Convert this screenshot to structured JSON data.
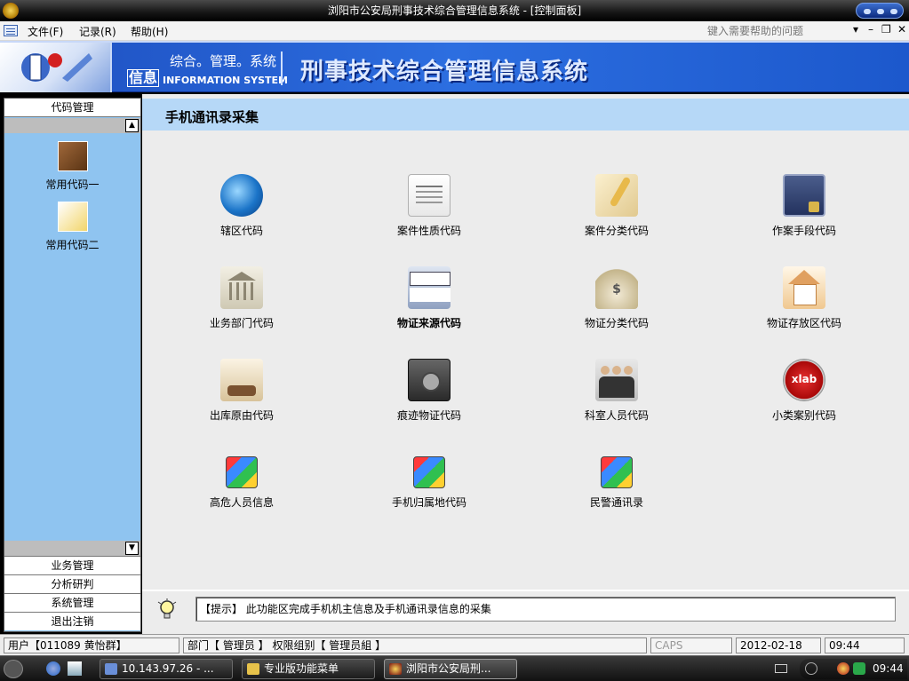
{
  "window": {
    "title": "浏阳市公安局刑事技术综合管理信息系统 - [控制面板]"
  },
  "menubar": {
    "items": [
      "文件(F)",
      "记录(R)",
      "帮助(H)"
    ],
    "help_placeholder": "键入需要帮助的问题",
    "controls": [
      "▾",
      "–",
      "❐",
      "✕"
    ]
  },
  "banner": {
    "info": "信息",
    "subtitle": "综合。管理。系统",
    "english": "INFORMATION SYSTEM",
    "title": "刑事技术综合管理信息系统"
  },
  "sidebar": {
    "header": "代码管理",
    "scroll_up": "▲",
    "scroll_down": "▼",
    "items": [
      {
        "label": "常用代码一",
        "icon": "book-icon"
      },
      {
        "label": "常用代码二",
        "icon": "notepad-icon"
      }
    ],
    "bottom_sections": [
      "业务管理",
      "分析研判",
      "系统管理",
      "退出注销"
    ]
  },
  "main": {
    "section_title": "手机通讯录采集",
    "modules": [
      {
        "label": "辖区代码",
        "icon": "globe-cursor-icon"
      },
      {
        "label": "案件性质代码",
        "icon": "document-icon"
      },
      {
        "label": "案件分类代码",
        "icon": "quill-scroll-icon"
      },
      {
        "label": "作案手段代码",
        "icon": "door-lock-icon"
      },
      {
        "label": "业务部门代码",
        "icon": "bank-building-icon"
      },
      {
        "label": "物证来源代码",
        "icon": "police-van-icon"
      },
      {
        "label": "物证分类代码",
        "icon": "money-bag-icon"
      },
      {
        "label": "物证存放区代码",
        "icon": "house-icon"
      },
      {
        "label": "出库原由代码",
        "icon": "paper-coffee-icon"
      },
      {
        "label": "痕迹物证代码",
        "icon": "safe-money-icon"
      },
      {
        "label": "科室人员代码",
        "icon": "people-icon"
      },
      {
        "label": "小类案别代码",
        "icon": "xlab-gear-icon"
      },
      {
        "label": "高危人员信息",
        "icon": "cubes-icon"
      },
      {
        "label": "手机归属地代码",
        "icon": "cubes-icon"
      },
      {
        "label": "民警通讯录",
        "icon": "cubes-icon"
      }
    ],
    "hint": "【提示】 此功能区完成手机机主信息及手机通讯录信息的采集"
  },
  "statusbar": {
    "user": "用户【011089 黄怡群】",
    "dept": "部门【 管理员 】 权限组别【 管理员組 】",
    "caps": "CAPS",
    "date": "2012-02-18",
    "time": "09:44"
  },
  "taskbar": {
    "tasks": [
      "10.143.97.26 - ...",
      "专业版功能菜单",
      "浏阳市公安局刑..."
    ],
    "clock": "09:44"
  },
  "colors": {
    "banner_blue": "#2c6ee0",
    "sidebar_blue": "#8fc4f0",
    "header_blue": "#b6d8f7",
    "main_bg": "#ececec"
  }
}
